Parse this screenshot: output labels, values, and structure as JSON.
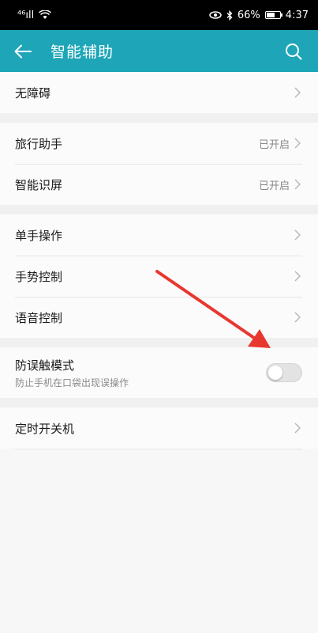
{
  "status": {
    "signal": "⁴⁶ıll",
    "wifi": "wifi",
    "battery_percent": "66%",
    "time": "4:37",
    "battery_level": 0.66
  },
  "app_bar": {
    "title": "智能辅助",
    "back_icon": "arrow-left-icon",
    "search_icon": "search-icon"
  },
  "groups": {
    "g1": [
      {
        "label": "无障碍"
      }
    ],
    "g2": [
      {
        "label": "旅行助手",
        "value": "已开启"
      },
      {
        "label": "智能识屏",
        "value": "已开启"
      }
    ],
    "g3": [
      {
        "label": "单手操作"
      },
      {
        "label": "手势控制"
      },
      {
        "label": "语音控制"
      }
    ],
    "g4": {
      "label": "防误触模式",
      "sub": "防止手机在口袋出现误操作",
      "toggle_on": false
    },
    "g5": [
      {
        "label": "定时开关机"
      }
    ]
  },
  "colors": {
    "accent": "#1ea6b8",
    "arrow": "#e8372f"
  }
}
